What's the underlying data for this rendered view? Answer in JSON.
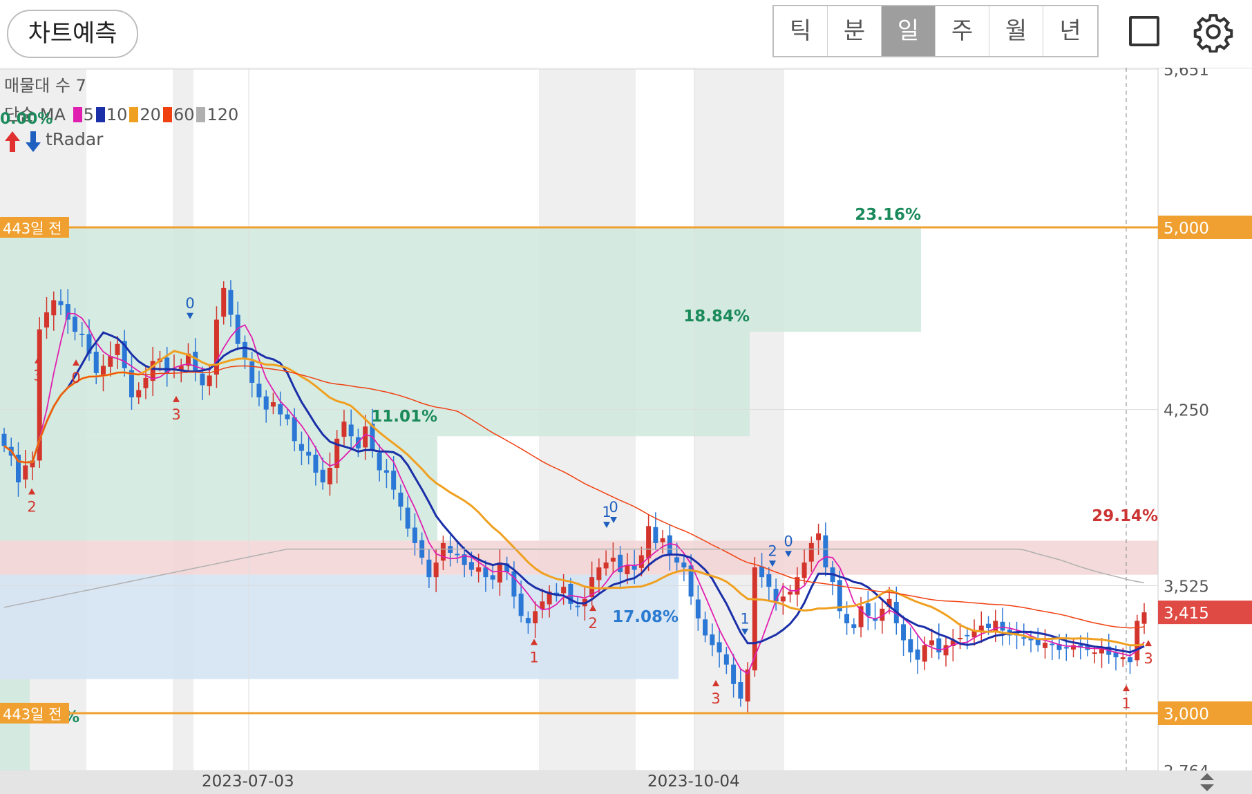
{
  "toolbar": {
    "predict_label": "차트예측",
    "periods": [
      "틱",
      "분",
      "일",
      "주",
      "월",
      "년"
    ],
    "active_period": "일",
    "icons": [
      "square-icon",
      "gear-icon"
    ]
  },
  "legend": {
    "volume_profile": "매물대 수 7",
    "ma_title": "단순 MA",
    "ma_items": [
      {
        "label": "5",
        "color": "#e01fb0"
      },
      {
        "label": "10",
        "color": "#1a2fa8"
      },
      {
        "label": "20",
        "color": "#f0a020"
      },
      {
        "label": "60",
        "color": "#f04010"
      },
      {
        "label": "120",
        "color": "#b0b0b0"
      }
    ],
    "tradar": "tRadar",
    "top_percent": "0.00%"
  },
  "chart_data": {
    "type": "candlestick",
    "y_ticks": [
      "5,651",
      "4,250",
      "3,525",
      "2,764"
    ],
    "ylim": [
      2700,
      5700
    ],
    "x_ticks": [
      "2023-07-03",
      "2023-10-04"
    ],
    "price_lines": [
      {
        "label": "443일 전",
        "value": 5000,
        "axis_label": "5,000"
      },
      {
        "label": "443일 전",
        "value": 3000,
        "axis_label": "3,000"
      }
    ],
    "current_price": {
      "value": 3415,
      "label": "3,415"
    },
    "volume_profile_zones": [
      {
        "from": 4570,
        "to": 5000,
        "percent": "23.16%",
        "tone": "green"
      },
      {
        "from": 4140,
        "to": 4570,
        "percent": "18.84%",
        "tone": "green"
      },
      {
        "from": 3710,
        "to": 4140,
        "percent": "11.01%",
        "tone": "green"
      },
      {
        "from": 3570,
        "to": 3710,
        "percent": "29.14%",
        "tone": "red"
      },
      {
        "from": 3140,
        "to": 3570,
        "percent": "17.08%",
        "tone": "blue"
      },
      {
        "from": 2700,
        "to": 3140,
        "percent": "0.77%",
        "tone": "green"
      }
    ],
    "signals": [
      {
        "label": "3"
      },
      {
        "label": "2"
      },
      {
        "label": "0"
      },
      {
        "label": "0"
      },
      {
        "label": "3"
      },
      {
        "label": "1"
      },
      {
        "label": "0"
      },
      {
        "label": "2"
      },
      {
        "label": "1"
      },
      {
        "label": "1"
      },
      {
        "label": "2"
      },
      {
        "label": "0"
      },
      {
        "label": "3"
      },
      {
        "label": "1"
      },
      {
        "label": "3"
      }
    ],
    "ma_names": [
      "5",
      "10",
      "20",
      "60",
      "120"
    ],
    "closes": [
      4100,
      4060,
      3950,
      4020,
      4040,
      4580,
      4650,
      4700,
      4680,
      4620,
      4570,
      4560,
      4480,
      4400,
      4430,
      4470,
      4520,
      4420,
      4300,
      4330,
      4380,
      4450,
      4460,
      4400,
      4420,
      4430,
      4480,
      4410,
      4350,
      4390,
      4620,
      4750,
      4640,
      4520,
      4460,
      4360,
      4300,
      4250,
      4280,
      4230,
      4210,
      4120,
      4080,
      4060,
      3990,
      3950,
      4010,
      4130,
      4200,
      4140,
      4090,
      4180,
      4080,
      4000,
      3990,
      3920,
      3850,
      3760,
      3700,
      3640,
      3560,
      3620,
      3700,
      3660,
      3650,
      3610,
      3590,
      3600,
      3560,
      3550,
      3620,
      3580,
      3480,
      3400,
      3370,
      3420,
      3460,
      3500,
      3490,
      3520,
      3450,
      3440,
      3470,
      3560,
      3600,
      3620,
      3640,
      3580,
      3610,
      3590,
      3650,
      3770,
      3700,
      3720,
      3650,
      3620,
      3600,
      3480,
      3390,
      3320,
      3280,
      3250,
      3200,
      3120,
      3060,
      3180,
      3600,
      3560,
      3520,
      3460,
      3480,
      3500,
      3560,
      3620,
      3700,
      3740,
      3600,
      3540,
      3420,
      3370,
      3350,
      3440,
      3400,
      3380,
      3430,
      3470,
      3370,
      3300,
      3250,
      3220,
      3280,
      3300,
      3250,
      3280,
      3300,
      3310,
      3320,
      3340,
      3360,
      3350,
      3380,
      3340,
      3320,
      3320,
      3310,
      3300,
      3280,
      3290,
      3280,
      3260,
      3270,
      3280,
      3270,
      3260,
      3250,
      3270,
      3240,
      3230,
      3230,
      3210,
      3380,
      3415
    ]
  },
  "colors": {
    "up": "#d3352c",
    "down": "#2a77d6",
    "zone_green": "#cfe8dd",
    "zone_red": "#f2d3d3",
    "zone_blue": "#d2e3f3",
    "price_line": "#f0a030",
    "current_price": "#e04a44"
  }
}
